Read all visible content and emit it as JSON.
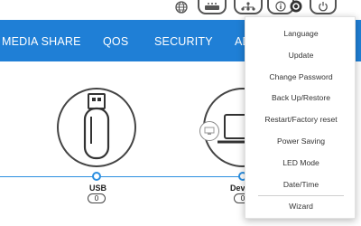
{
  "topbar": {
    "icons": [
      "globe-icon",
      "router-icon",
      "network-icon",
      "info-icon",
      "gear-icon",
      "power-icon"
    ]
  },
  "nav": {
    "items": [
      "MEDIA SHARE",
      "QOS",
      "SECURITY",
      "AD"
    ]
  },
  "dashboard": {
    "usb_label": "USB",
    "usb_count": "0",
    "devices_label": "Devi",
    "devices_count": "0"
  },
  "menu": {
    "items": [
      "Language",
      "Update",
      "Change Password",
      "Back Up/Restore",
      "Restart/Factory reset",
      "Power Saving",
      "LED Mode",
      "Date/Time"
    ],
    "wizard": "Wizard"
  }
}
